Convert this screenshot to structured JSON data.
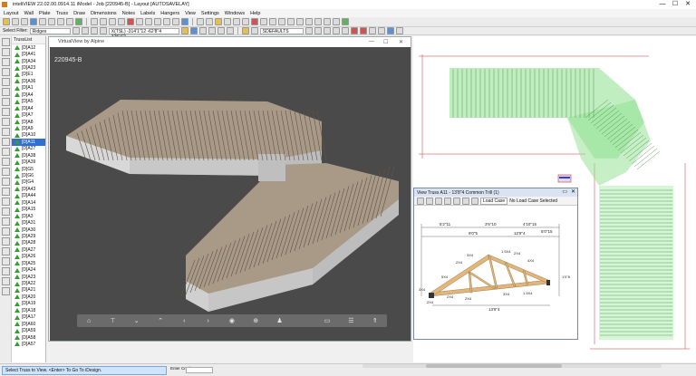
{
  "app": {
    "title": "inteliVIEW 22.02.00.0914.11 iModel - Job [220945-B] - Layout [AUTOSAVELAY]",
    "minimize": "—",
    "maximize": "☐",
    "close": "✕"
  },
  "menu": [
    "Layout",
    "Wall",
    "Plate",
    "Truss",
    "Draw",
    "Dimensions",
    "Notes",
    "Labels",
    "Hangers",
    "View",
    "Settings",
    "Windows",
    "Help"
  ],
  "toolbar2": {
    "select_filter_label": "Select Filter:",
    "select_filter_value": "Ridges",
    "coord_field": "X(TSL) -314'1\"12  -62'8\"4  325'4\"1",
    "layer_field": "SDEFAULTS"
  },
  "truss_list": {
    "header": "TrussList",
    "items": [
      "[D]A12",
      "[D]A41",
      "[D]A34",
      "[D]A23",
      "[D]E1",
      "[D]A36",
      "[D]A1",
      "[D]A4",
      "[D]A5",
      "[D]A4",
      "[D]A7",
      "[D]A8",
      "[D]A9",
      "[D]A10",
      "[D]A11",
      "[D]A27",
      "[D]A38",
      "[D]A39",
      "[D]G5",
      "[D]G6",
      "[D]G4",
      "[D]A43",
      "[D]A44",
      "[D]A14",
      "[D]A15",
      "[D]A3",
      "[D]A31",
      "[D]A30",
      "[D]A29",
      "[D]A28",
      "[D]A27",
      "[D]A26",
      "[D]A25",
      "[D]A24",
      "[D]A23",
      "[D]A22",
      "[D]A21",
      "[D]A20",
      "[D]A19",
      "[D]A18",
      "[D]A17",
      "[D]A60",
      "[D]A59",
      "[D]A58",
      "[D]A57"
    ],
    "selected_index": 14
  },
  "viewer": {
    "window_title": "VirtualView by Alpine",
    "job_label": "220945-B",
    "nav_icons": [
      "home-icon",
      "top-view-icon",
      "chevron-down-icon",
      "chevron-up-icon",
      "chevron-left-icon",
      "chevron-right-icon",
      "eye-icon",
      "zoom-icon",
      "person-icon",
      "blank-icon",
      "rows-icon",
      "columns-icon",
      "walk-icon"
    ],
    "nav_glyphs": [
      "⌂",
      "⊤",
      "⌄",
      "⌃",
      "‹",
      "›",
      "◉",
      "⊕",
      "♟",
      "",
      "▭",
      "☰",
      "⇑"
    ]
  },
  "truss_window": {
    "title": "View Truss  A11 - 13'8\"4 Common Trill (1)",
    "load_case_button": "Load Case",
    "load_case_status": "No Load Case Selected",
    "dims_top": [
      "5'2\"11",
      "3'6\"10",
      "4'10\"15",
      "5'0\"15"
    ],
    "dims_top2": [
      "9'0\"5",
      "12'8\"4"
    ],
    "labels": [
      "2X4",
      "3X4",
      "1.5X4",
      "2X4",
      "4X4",
      "5X4",
      "2X4",
      "3X4",
      "1.5X4",
      "3X4",
      "2X4"
    ],
    "bottom_dim": "13'8\"4",
    "left_mark": "2X4",
    "right_mark": "1'0\"8"
  },
  "status": {
    "prompt": "Select Truss to View.  <Enter> To Go To iDesign.",
    "enter_label": "Enter Cmd"
  }
}
